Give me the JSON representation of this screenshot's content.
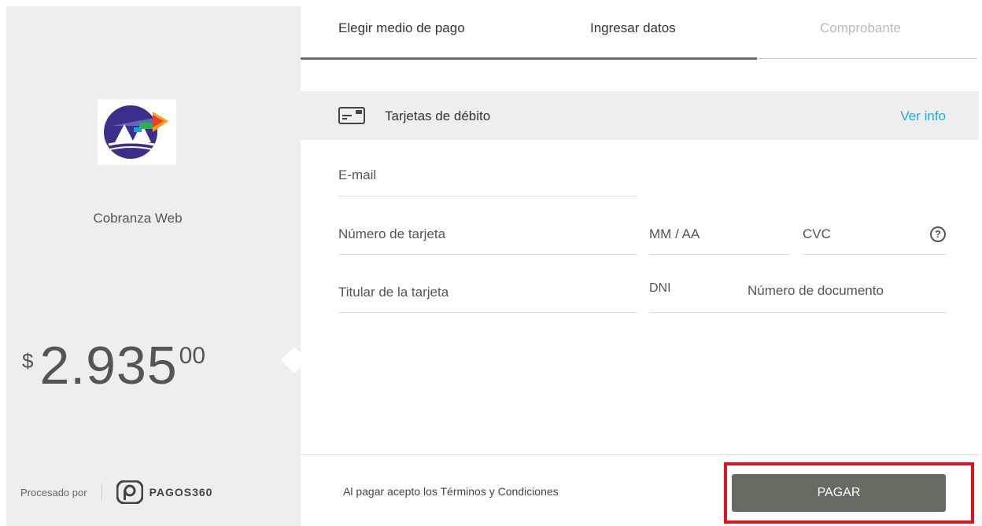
{
  "merchant": {
    "name": "Cobranza Web"
  },
  "amount": {
    "currency": "$",
    "integer": "2.935",
    "decimals": "00"
  },
  "processed_by": {
    "label": "Procesado por",
    "brand": "PAGOS360"
  },
  "steps": [
    {
      "label": "Elegir medio de pago",
      "state": "done"
    },
    {
      "label": "Ingresar datos",
      "state": "active"
    },
    {
      "label": "Comprobante",
      "state": "disabled"
    }
  ],
  "card_type": {
    "title": "Tarjetas de débito",
    "info_link": "Ver info",
    "icon": "credit-card-icon"
  },
  "form": {
    "email_placeholder": "E-mail",
    "card_number_placeholder": "Número de tarjeta",
    "expiry_placeholder": "MM / AA",
    "cvc_placeholder": "CVC",
    "cvc_help": "?",
    "holder_placeholder": "Titular de la tarjeta",
    "doc_type": "DNI",
    "doc_number_placeholder": "Número de documento"
  },
  "footer": {
    "terms": "Al pagar acepto los Términos y Condiciones",
    "pay_label": "PAGAR"
  },
  "colors": {
    "accent_link": "#2aa8dc",
    "pay_button": "#666b62",
    "highlight": "#e0141e",
    "panel": "#eeeeee"
  }
}
